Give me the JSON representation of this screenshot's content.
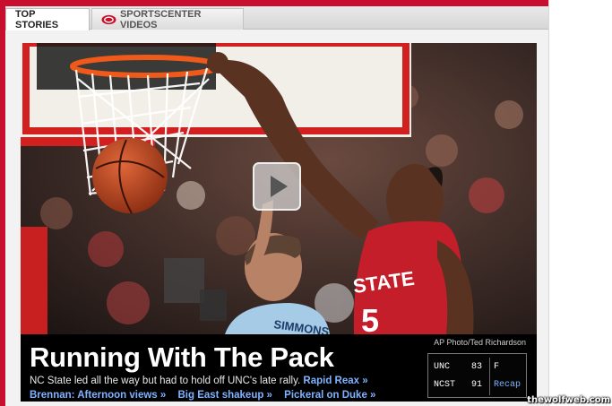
{
  "tabs": {
    "top_stories": "TOP STORIES",
    "sc_videos": "SPORTSCENTER VIDEOS"
  },
  "hero": {
    "credit": "AP Photo/Ted Richardson",
    "jersey_text": "STATE",
    "jersey_number": "5",
    "opponent_jersey_text": "SIMMONS"
  },
  "story": {
    "headline": "Running With The Pack",
    "summary": "NC State led all the way but had to hold off UNC's late rally.",
    "links": {
      "rapid_reax": "Rapid Reax »",
      "brennan": "Brennan: Afternoon views »",
      "big_east": "Big East shakeup »",
      "pickeral": "Pickeral on Duke »"
    }
  },
  "scoreboard": {
    "team1": "UNC",
    "score1": "83",
    "status": "F",
    "team2": "NCST",
    "score2": "91",
    "recap": "Recap"
  },
  "watermark": "thewolfweb.com",
  "colors": {
    "espn_red": "#c8102e",
    "link_blue": "#7fb2ff",
    "caption_bg": "#000000"
  }
}
